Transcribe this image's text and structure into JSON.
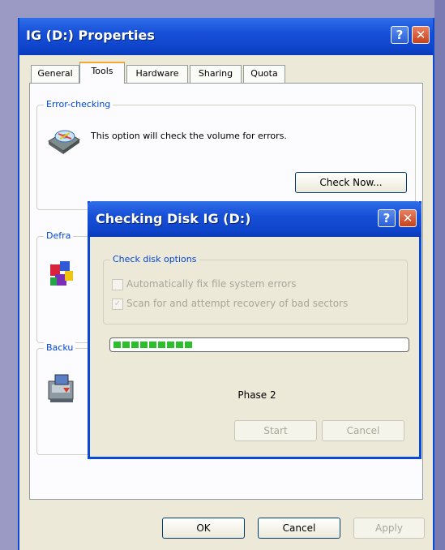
{
  "window": {
    "title": "IG (D:) Properties",
    "help_glyph": "?",
    "close_glyph": "✕"
  },
  "tabs": [
    {
      "label": "General"
    },
    {
      "label": "Tools"
    },
    {
      "label": "Hardware"
    },
    {
      "label": "Sharing"
    },
    {
      "label": "Quota"
    }
  ],
  "active_tab": "Tools",
  "error_checking": {
    "group_label": "Error-checking",
    "description": "This option will check the volume for errors.",
    "button_label": "Check Now..."
  },
  "defrag": {
    "group_label_partial": "Defra"
  },
  "backup": {
    "group_label_partial": "Backu"
  },
  "dialog": {
    "title": "Checking Disk IG (D:)",
    "options_label": "Check disk options",
    "option_fix": {
      "label": "Automatically fix file system errors",
      "checked": false
    },
    "option_scan": {
      "label": "Scan for and attempt recovery of bad sectors",
      "checked": true
    },
    "progress_segments": 9,
    "phase_text": "Phase 2",
    "start_label": "Start",
    "cancel_label": "Cancel"
  },
  "footer": {
    "ok_label": "OK",
    "cancel_label": "Cancel",
    "apply_label": "Apply"
  },
  "colors": {
    "titlebar": "#0d43c9",
    "face": "#ece9d8",
    "progress_fill": "#2bc02b",
    "group_label": "#0046d5"
  }
}
